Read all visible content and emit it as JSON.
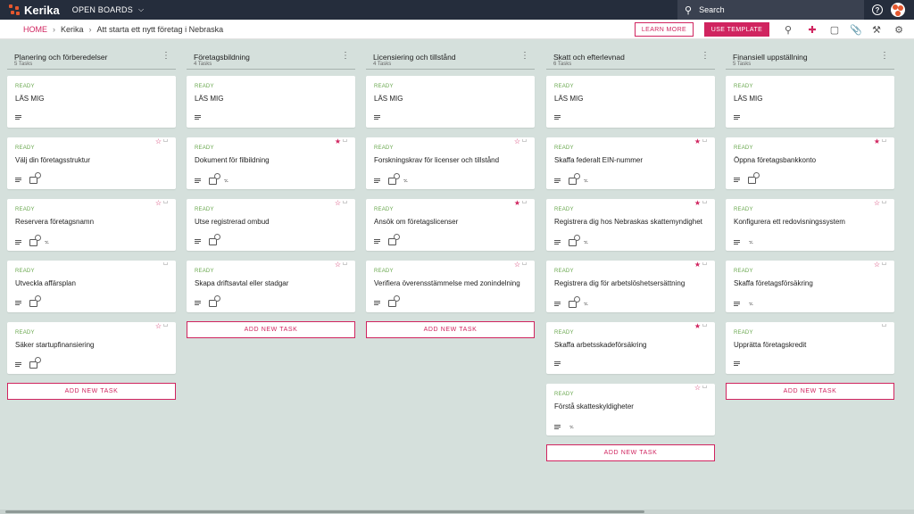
{
  "app": {
    "name": "Kerika",
    "open_boards": "OPEN BOARDS"
  },
  "search": {
    "placeholder": "Search"
  },
  "breadcrumb": {
    "home": "HOME",
    "account": "Kerika",
    "board": "Att starta ett nytt företag i Nebraska"
  },
  "buttons": {
    "learn_more": "LEARN MORE",
    "use_template": "USE TEMPLATE",
    "add_task": "ADD NEW TASK"
  },
  "colors": {
    "accent": "#d0245f",
    "ready": "#6aa84f",
    "topbar": "#252d3c",
    "board_bg": "#d5e0dc"
  },
  "columns": [
    {
      "title": "Planering och förberedelser",
      "count": "5 Tasks",
      "cards": [
        {
          "status": "READY",
          "title": "LÄS MIG",
          "star": "none",
          "checklist": false,
          "attachment": false
        },
        {
          "status": "READY",
          "title": "Välj din företagsstruktur",
          "star": "empty",
          "checklist": true,
          "attachment": false
        },
        {
          "status": "READY",
          "title": "Reservera företagsnamn",
          "star": "empty",
          "checklist": true,
          "attachment": true
        },
        {
          "status": "READY",
          "title": "Utveckla affärsplan",
          "star": "none",
          "checklist": true,
          "attachment": false
        },
        {
          "status": "READY",
          "title": "Säker startupfinansiering",
          "star": "empty",
          "checklist": true,
          "attachment": false
        }
      ]
    },
    {
      "title": "Företagsbildning",
      "count": "4 Tasks",
      "cards": [
        {
          "status": "READY",
          "title": "LÄS MIG",
          "star": "none",
          "checklist": false,
          "attachment": false
        },
        {
          "status": "READY",
          "title": "Dokument för filbildning",
          "star": "filled",
          "checklist": true,
          "attachment": true
        },
        {
          "status": "READY",
          "title": "Utse registrerad ombud",
          "star": "empty",
          "checklist": true,
          "attachment": false
        },
        {
          "status": "READY",
          "title": "Skapa driftsavtal eller stadgar",
          "star": "empty",
          "checklist": true,
          "attachment": false
        }
      ]
    },
    {
      "title": "Licensiering och tillstånd",
      "count": "4 Tasks",
      "cards": [
        {
          "status": "READY",
          "title": "LÄS MIG",
          "star": "none",
          "checklist": false,
          "attachment": false
        },
        {
          "status": "READY",
          "title": "Forskningskrav för licenser och tillstånd",
          "star": "empty",
          "checklist": true,
          "attachment": true
        },
        {
          "status": "READY",
          "title": "Ansök om företagslicenser",
          "star": "filled",
          "checklist": true,
          "attachment": false
        },
        {
          "status": "READY",
          "title": "Verifiera överensstämmelse med zonindelning",
          "star": "empty",
          "checklist": true,
          "attachment": false
        }
      ]
    },
    {
      "title": "Skatt och efterlevnad",
      "count": "6 Tasks",
      "cards": [
        {
          "status": "READY",
          "title": "LÄS MIG",
          "star": "none",
          "checklist": false,
          "attachment": false
        },
        {
          "status": "READY",
          "title": "Skaffa federalt EIN-nummer",
          "star": "filled",
          "checklist": true,
          "attachment": true
        },
        {
          "status": "READY",
          "title": "Registrera dig hos Nebraskas skattemyndighet",
          "star": "filled",
          "checklist": true,
          "attachment": true
        },
        {
          "status": "READY",
          "title": "Registrera dig för arbetslöshetsersättning",
          "star": "filled",
          "checklist": true,
          "attachment": true
        },
        {
          "status": "READY",
          "title": "Skaffa arbetsskadeförsäkring",
          "star": "filled",
          "checklist": false,
          "attachment": false
        },
        {
          "status": "READY",
          "title": "Förstå skatteskyldigheter",
          "star": "empty",
          "checklist": false,
          "attachment": true
        }
      ]
    },
    {
      "title": "Finansiell uppställning",
      "count": "5 Tasks",
      "cards": [
        {
          "status": "READY",
          "title": "LÄS MIG",
          "star": "none",
          "checklist": false,
          "attachment": false
        },
        {
          "status": "READY",
          "title": "Öppna företagsbankkonto",
          "star": "filled",
          "checklist": true,
          "attachment": false
        },
        {
          "status": "READY",
          "title": "Konfigurera ett redovisningssystem",
          "star": "empty",
          "checklist": false,
          "attachment": true
        },
        {
          "status": "READY",
          "title": "Skaffa företagsförsäkring",
          "star": "empty",
          "checklist": false,
          "attachment": true
        },
        {
          "status": "READY",
          "title": "Upprätta företagskredit",
          "star": "none",
          "checklist": false,
          "attachment": false
        }
      ]
    }
  ]
}
